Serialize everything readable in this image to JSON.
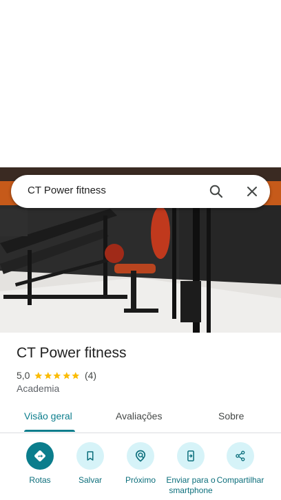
{
  "search": {
    "query": "CT Power fitness"
  },
  "place": {
    "name": "CT Power fitness",
    "rating": "5,0",
    "stars": 5,
    "review_count": "(4)",
    "category": "Academia"
  },
  "tabs": [
    {
      "label": "Visão geral",
      "active": true
    },
    {
      "label": "Avaliações",
      "active": false
    },
    {
      "label": "Sobre",
      "active": false
    }
  ],
  "actions": [
    {
      "label": "Rotas",
      "icon": "directions-icon"
    },
    {
      "label": "Salvar",
      "icon": "bookmark-icon"
    },
    {
      "label": "Próximo",
      "icon": "nearby-icon"
    },
    {
      "label": "Enviar para o smartphone",
      "icon": "send-to-phone-icon"
    },
    {
      "label": "Compartilhar",
      "icon": "share-icon"
    }
  ],
  "colors": {
    "accent": "#0b7d8c",
    "accent_light": "#d6f3f8",
    "star": "#fbbc04"
  }
}
